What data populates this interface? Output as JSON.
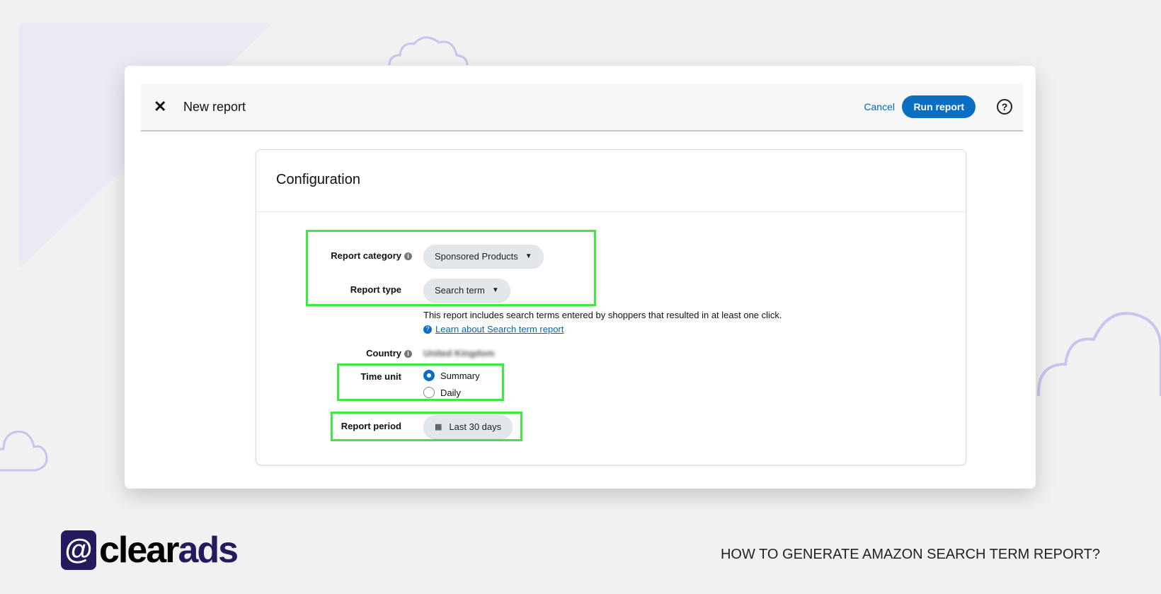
{
  "header": {
    "title": "New report",
    "cancel_label": "Cancel",
    "run_label": "Run report",
    "close_icon": "close-icon",
    "help_icon": "help-icon"
  },
  "config": {
    "title": "Configuration",
    "report_category": {
      "label": "Report category",
      "value": "Sponsored Products"
    },
    "report_type": {
      "label": "Report type",
      "value": "Search term",
      "description": "This report includes search terms entered by shoppers that resulted in at least one click.",
      "link": "Learn about Search term report"
    },
    "country": {
      "label": "Country",
      "value": "United Kingdom"
    },
    "time_unit": {
      "label": "Time unit",
      "options": [
        "Summary",
        "Daily"
      ],
      "selected": "Summary"
    },
    "report_period": {
      "label": "Report period",
      "value": "Last 30 days"
    }
  },
  "branding": {
    "logo_text": "clearads",
    "tagline": "HOW TO GENERATE AMAZON SEARCH TERM REPORT?"
  },
  "colors": {
    "accent": "#0a6fc2",
    "highlight": "#3fe83f",
    "brand": "#241a5e"
  }
}
